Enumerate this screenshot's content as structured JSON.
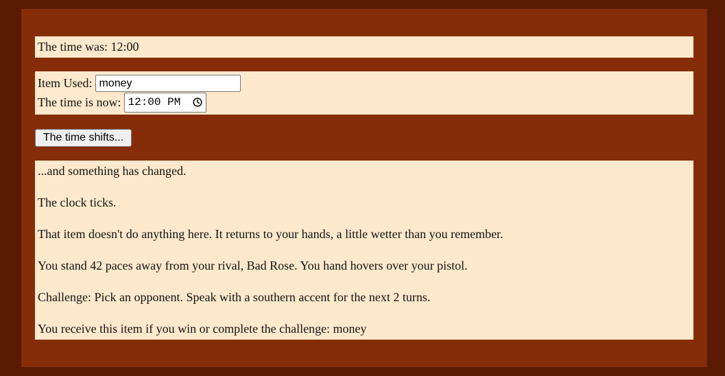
{
  "time_was": {
    "label": "The time was:",
    "value": "12:00"
  },
  "item_used": {
    "label": "Item Used:",
    "value": "money"
  },
  "time_now": {
    "label": "The time is now:",
    "value": "12:00 PM",
    "icon": "clock-icon"
  },
  "shift_button": {
    "label": "The time shifts..."
  },
  "story": {
    "lines": [
      "...and something has changed.",
      "The clock ticks.",
      "That item doesn't do anything here. It returns to your hands, a little wetter than you remember.",
      "You stand 42 paces away from your rival, Bad Rose. You hand hovers over your pistol.",
      "Challenge: Pick an opponent. Speak with a southern accent for the next 2 turns.",
      "You receive this item if you win or complete the challenge: money"
    ]
  },
  "colors": {
    "outer_background": "#5a1a04",
    "container_background": "#852d08",
    "panel_background": "#ffe9cc"
  }
}
